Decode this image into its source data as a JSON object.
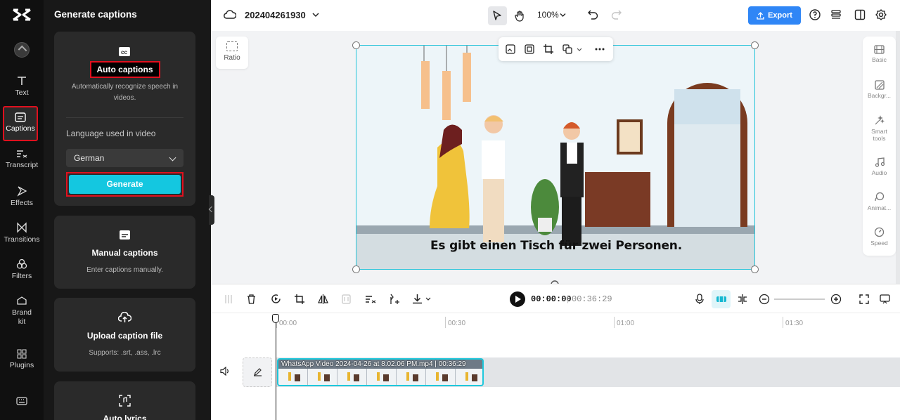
{
  "left_rail": {
    "items": [
      {
        "label": "Text"
      },
      {
        "label": "Captions"
      },
      {
        "label": "Transcript"
      },
      {
        "label": "Effects"
      },
      {
        "label": "Transitions"
      },
      {
        "label": "Filters"
      },
      {
        "label": "Brand kit"
      },
      {
        "label": "Plugins"
      }
    ]
  },
  "panel": {
    "title": "Generate captions",
    "auto": {
      "title": "Auto captions",
      "desc": "Automatically recognize speech in videos.",
      "lang_label": "Language used in video",
      "lang_value": "German",
      "generate_label": "Generate"
    },
    "manual": {
      "title": "Manual captions",
      "desc": "Enter captions manually."
    },
    "upload": {
      "title": "Upload caption file",
      "desc": "Supports: .srt, .ass, .lrc"
    },
    "lyrics": {
      "title": "Auto lyrics"
    }
  },
  "topbar": {
    "project_name": "202404261930",
    "zoom": "100%",
    "export_label": "Export"
  },
  "stage": {
    "ratio_label": "Ratio",
    "subtitle": "Es gibt einen Tisch für zwei Personen."
  },
  "right_rail": {
    "items": [
      {
        "label": "Basic"
      },
      {
        "label": "Backgr..."
      },
      {
        "label": "Smart tools"
      },
      {
        "label": "Audio"
      },
      {
        "label": "Animat..."
      },
      {
        "label": "Speed"
      }
    ]
  },
  "timeline": {
    "current_time": "00:00:00",
    "separator": "|",
    "total_time": "00:36:29",
    "ruler": [
      "00:00",
      "00:30",
      "01:00",
      "01:30"
    ],
    "clip_name": "WhatsApp Video 2024-04-26 at 8.02.06 PM.mp4",
    "clip_duration": "00:36:29"
  },
  "colors": {
    "accent": "#14c7e0",
    "export": "#2f86f6",
    "highlight": "#e0101e",
    "selection": "#27c3d8"
  }
}
